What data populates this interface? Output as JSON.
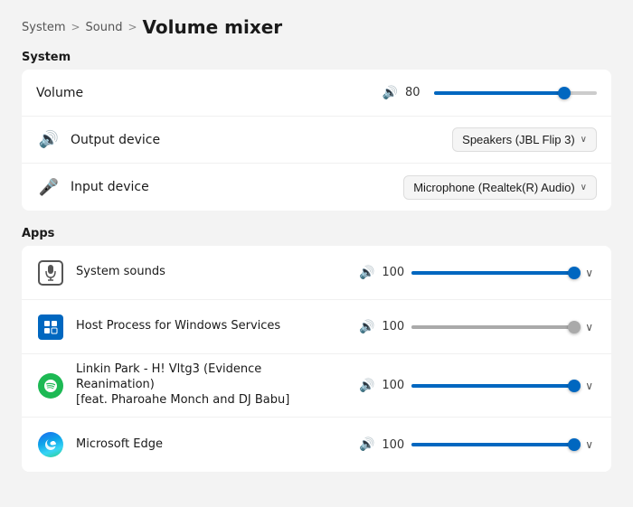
{
  "breadcrumb": {
    "system": "System",
    "sep1": ">",
    "sound": "Sound",
    "sep2": ">",
    "current": "Volume mixer"
  },
  "system_section": {
    "label": "System",
    "volume_row": {
      "label": "Volume",
      "value": "80",
      "fill_pct": 80
    },
    "output_row": {
      "label": "Output device",
      "device": "Speakers (JBL Flip 3)"
    },
    "input_row": {
      "label": "Input device",
      "device": "Microphone (Realtek(R) Audio)"
    }
  },
  "apps_section": {
    "label": "Apps",
    "apps": [
      {
        "name": "System sounds",
        "volume": "100",
        "fill_pct": 100,
        "thumb_color": "blue"
      },
      {
        "name": "Host Process for Windows Services",
        "volume": "100",
        "fill_pct": 100,
        "thumb_color": "gray"
      },
      {
        "name": "Linkin Park - H! Vltg3 (Evidence Reanimation)\n[feat. Pharoahe Monch and DJ Babu]",
        "name_line1": "Linkin Park - H! Vltg3 (Evidence Reanimation)",
        "name_line2": "[feat. Pharoahe Monch and DJ Babu]",
        "volume": "100",
        "fill_pct": 100,
        "thumb_color": "blue"
      },
      {
        "name": "Microsoft Edge",
        "volume": "100",
        "fill_pct": 100,
        "thumb_color": "blue"
      }
    ]
  },
  "icons": {
    "chevron_down": "⌄",
    "speaker": "🔊"
  }
}
